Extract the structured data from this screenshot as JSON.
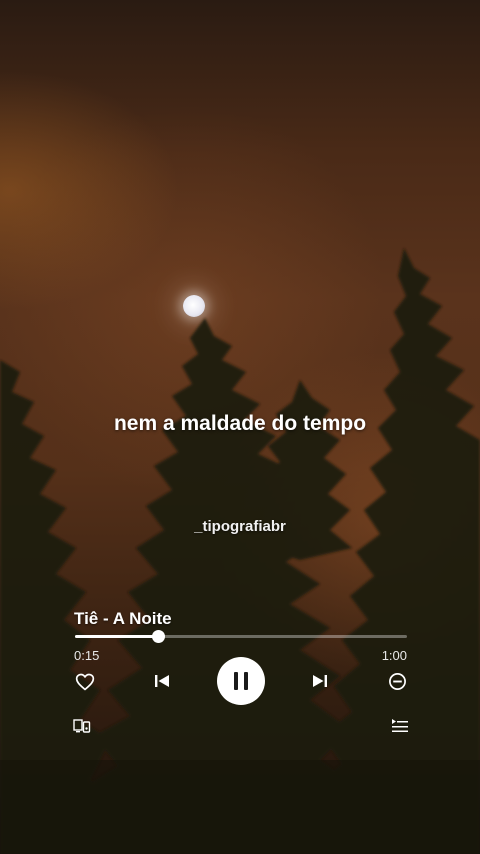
{
  "lyrics": {
    "line": "nem a maldade do tempo"
  },
  "watermark": {
    "handle": "_tipografiabr"
  },
  "player": {
    "track_title": "Tiê - A Noite",
    "time_elapsed": "0:15",
    "time_total": "1:00",
    "progress_fraction": 0.25,
    "state": "playing",
    "icons": {
      "like": "heart-icon",
      "previous": "skip-previous-icon",
      "play_pause": "pause-icon",
      "next": "skip-next-icon",
      "remove": "minus-circle-icon",
      "devices": "connect-device-icon",
      "queue": "queue-icon"
    }
  }
}
